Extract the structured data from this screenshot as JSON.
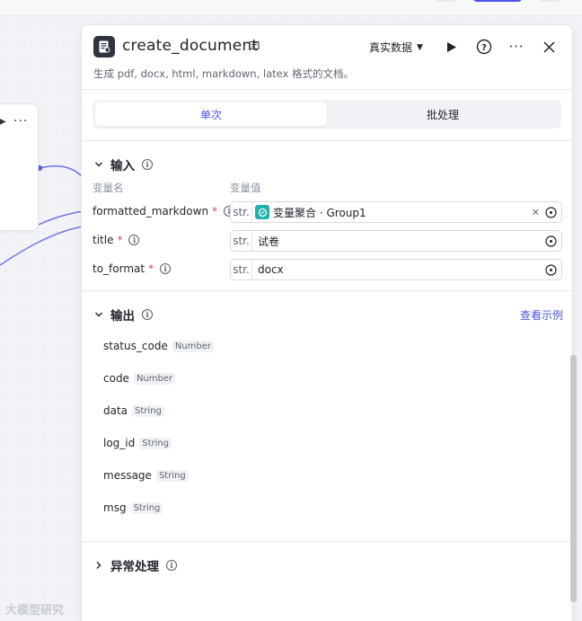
{
  "node": {
    "title": "create_document",
    "description": "生成 pdf, docx, html, markdown, latex 格式的文档。",
    "data_mode": "真实数据"
  },
  "tabs": [
    {
      "label": "单次",
      "active": true
    },
    {
      "label": "批处理",
      "active": false
    }
  ],
  "input": {
    "section_title": "输入",
    "col_name": "变量名",
    "col_value": "变量值",
    "rows": [
      {
        "name": "formatted_markdown",
        "type": "str.",
        "value": "变量聚合 · Group1",
        "is_ref": true
      },
      {
        "name": "title",
        "type": "str.",
        "value": "试卷",
        "is_ref": false
      },
      {
        "name": "to_format",
        "type": "str.",
        "value": "docx",
        "is_ref": false
      }
    ]
  },
  "output": {
    "section_title": "输出",
    "view_example": "查看示例",
    "fields": [
      {
        "name": "status_code",
        "type": "Number"
      },
      {
        "name": "code",
        "type": "Number"
      },
      {
        "name": "data",
        "type": "String"
      },
      {
        "name": "log_id",
        "type": "String"
      },
      {
        "name": "message",
        "type": "String"
      },
      {
        "name": "msg",
        "type": "String"
      }
    ]
  },
  "error_handling": {
    "section_title": "异常处理"
  },
  "watermark": "大模型研究"
}
